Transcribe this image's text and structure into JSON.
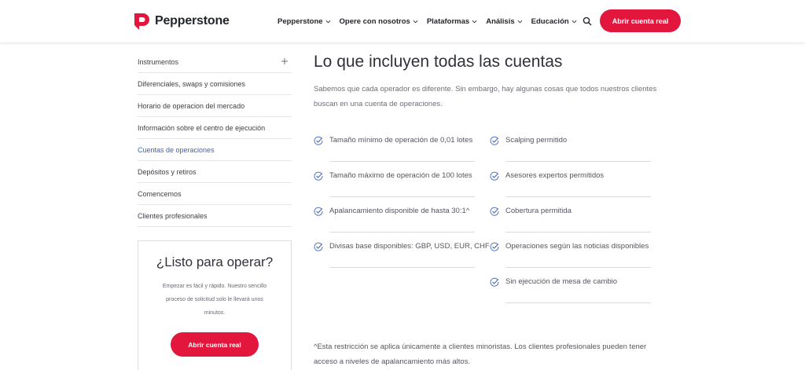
{
  "brand": {
    "name": "Pepperstone",
    "accent": "#e3173e",
    "link_active": "#3e62b6"
  },
  "nav": {
    "items": [
      {
        "label": "Pepperstone",
        "icon": "chevron-down-icon"
      },
      {
        "label": "Opere con nosotros",
        "icon": "chevron-down-icon"
      },
      {
        "label": "Plataformas",
        "icon": "chevron-down-icon"
      },
      {
        "label": "Análisis",
        "icon": "chevron-down-icon"
      },
      {
        "label": "Educación",
        "icon": "chevron-down-icon"
      }
    ],
    "search_icon": "search-icon",
    "cta": "Abrir cuenta real"
  },
  "sidebar": {
    "items": [
      {
        "label": "Instrumentos",
        "icon": "plus-icon"
      },
      {
        "label": "Diferenciales, swaps y comisiones"
      },
      {
        "label": "Horario de operacion del mercado"
      },
      {
        "label": "Información sobre el centro de ejecución"
      },
      {
        "label": "Cuentas de operaciones",
        "active": true
      },
      {
        "label": "Depósitos y retiros"
      },
      {
        "label": "Comencemos"
      },
      {
        "label": "Clientes profesionales"
      }
    ]
  },
  "ready": {
    "title": "¿Listo para operar?",
    "text": "Empezar es fácil y rápido. Nuestro sencillo proceso de solicitud solo le llevará unos minutos.",
    "cta": "Abrir cuenta real"
  },
  "main": {
    "title": "Lo que incluyen todas las cuentas",
    "intro": "Sabemos que cada operador es diferente. Sin embargo, hay algunas cosas que todos nuestros clientes buscan en una cuenta de operaciones.",
    "features_left": [
      "Tamaño mínimo de operación de 0,01 lotes",
      "Tamaño máximo de operación de 100 lotes",
      "Apalancamiento disponible de hasta 30:1^",
      "Divisas base disponibles: GBP, USD, EUR, CHF"
    ],
    "features_right": [
      "Scalping permitido",
      "Asesores expertos permitidos",
      "Cobertura permitida",
      "Operaciones según las noticias disponibles",
      "Sin ejecución de mesa de cambio"
    ],
    "check_icon": "check-circle-icon",
    "note": "^Esta restricción se aplica únicamente a clientes minoristas. Los clientes profesionales pueden tener acceso a niveles de apalancamiento más altos."
  }
}
